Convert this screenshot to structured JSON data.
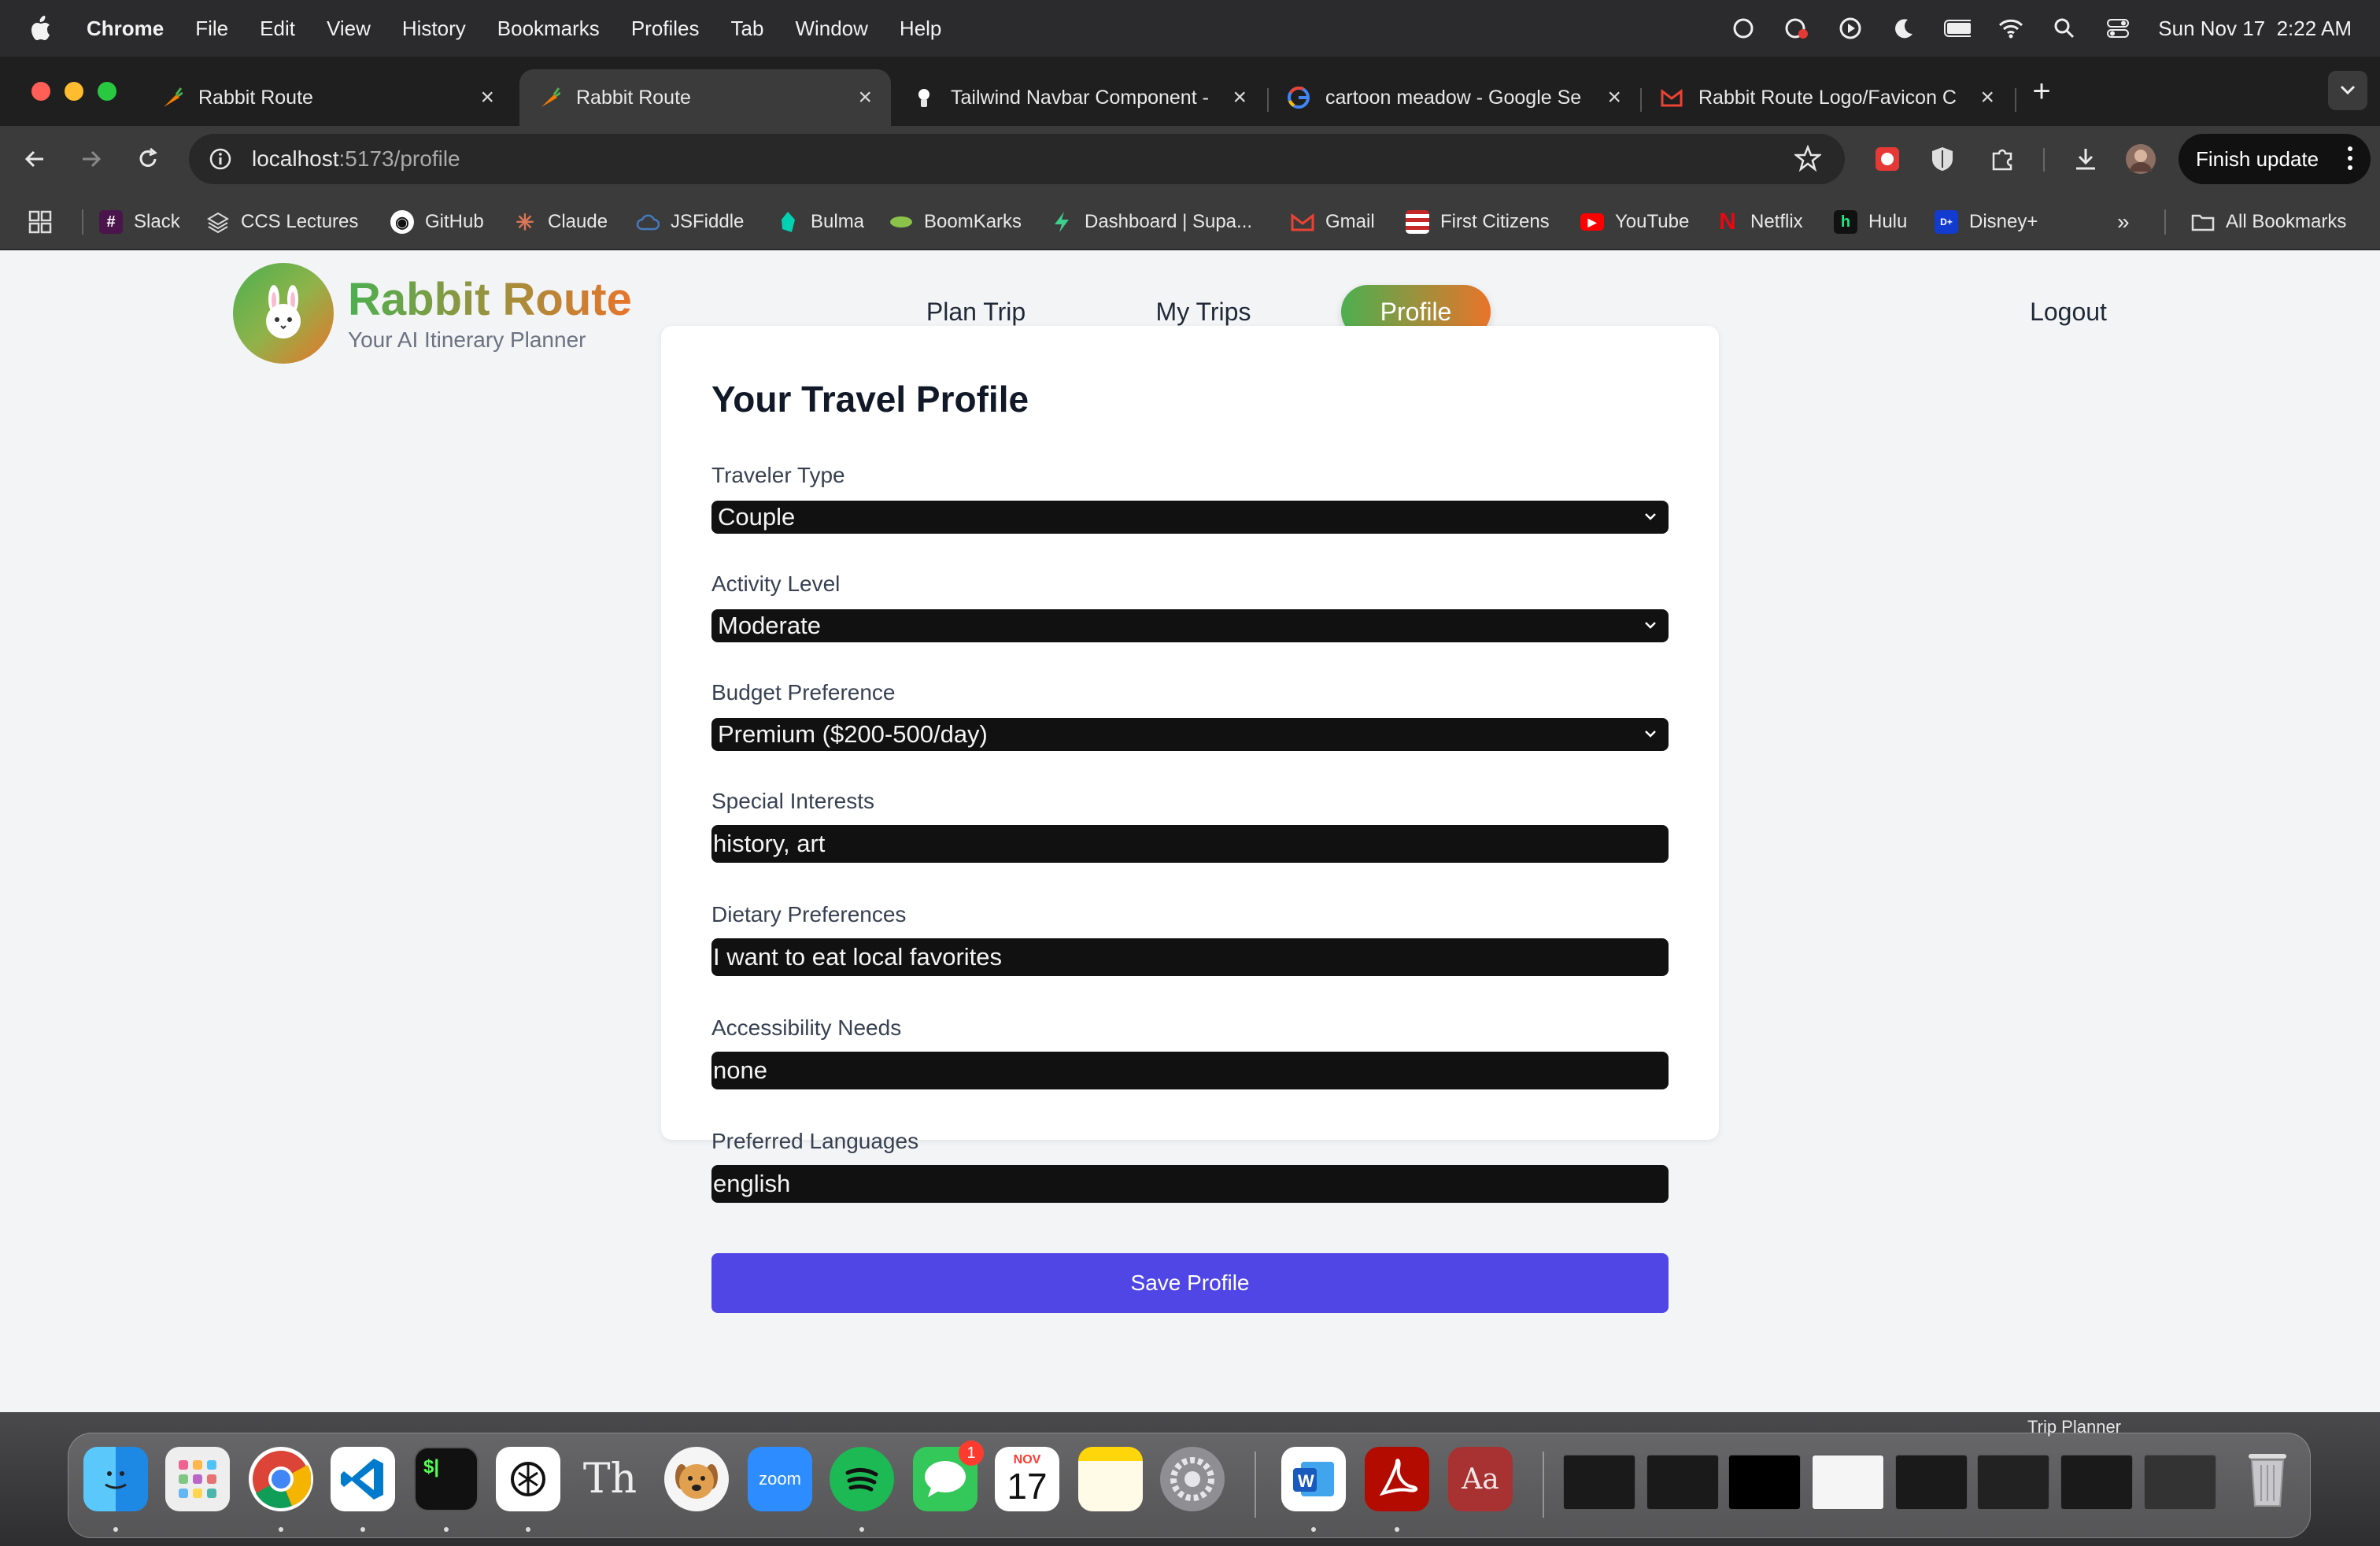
{
  "menubar": {
    "app": "Chrome",
    "items": [
      "File",
      "Edit",
      "View",
      "History",
      "Bookmarks",
      "Profiles",
      "Tab",
      "Window",
      "Help"
    ],
    "clock": "Sun Nov 17  2:22 AM"
  },
  "tabs": [
    {
      "title": "Rabbit Route",
      "favicon": "carrot-icon"
    },
    {
      "title": "Rabbit Route",
      "favicon": "carrot-icon",
      "active": true
    },
    {
      "title": "Tailwind Navbar Component -",
      "favicon": "tailwind-icon"
    },
    {
      "title": "cartoon meadow - Google Se",
      "favicon": "google-icon"
    },
    {
      "title": "Rabbit Route Logo/Favicon C",
      "favicon": "gmail-icon"
    }
  ],
  "toolbar": {
    "url_host": "localhost",
    "url_path": ":5173/profile",
    "finish_update": "Finish update"
  },
  "bookmarks": [
    {
      "label": "Slack",
      "icon": "slack-icon",
      "color": "#e01e5a"
    },
    {
      "label": "CCS Lectures",
      "icon": "layers-icon",
      "color": "#888888"
    },
    {
      "label": "GitHub",
      "icon": "github-icon",
      "color": "#ffffff"
    },
    {
      "label": "Claude",
      "icon": "claude-icon",
      "color": "#d97757"
    },
    {
      "label": "JSFiddle",
      "icon": "cloud-icon",
      "color": "#4679bd"
    },
    {
      "label": "Bulma",
      "icon": "bulma-icon",
      "color": "#00d1b2"
    },
    {
      "label": "BoomKarks",
      "icon": "boom-icon",
      "color": "#8bc34a"
    },
    {
      "label": "Dashboard | Supa...",
      "icon": "supabase-icon",
      "color": "#3ecf8e"
    },
    {
      "label": "Gmail",
      "icon": "gmail-icon",
      "color": "#ea4335"
    },
    {
      "label": "First Citizens",
      "icon": "flag-icon",
      "color": "#1e4a8c"
    },
    {
      "label": "YouTube",
      "icon": "youtube-icon",
      "color": "#ff0000"
    },
    {
      "label": "Netflix",
      "icon": "netflix-icon",
      "color": "#e50914"
    },
    {
      "label": "Hulu",
      "icon": "hulu-icon",
      "color": "#1ce783"
    },
    {
      "label": "Disney+",
      "icon": "disney-icon",
      "color": "#113ccf"
    }
  ],
  "all_bookmarks": "All Bookmarks",
  "app": {
    "brand": "Rabbit Route",
    "tagline": "Your AI Itinerary Planner",
    "nav": {
      "plan": "Plan Trip",
      "trips": "My Trips",
      "profile": "Profile",
      "logout": "Logout"
    },
    "form": {
      "title": "Your Travel Profile",
      "traveler_type": {
        "label": "Traveler Type",
        "value": "Couple"
      },
      "activity_level": {
        "label": "Activity Level",
        "value": "Moderate"
      },
      "budget": {
        "label": "Budget Preference",
        "value": "Premium ($200-500/day)"
      },
      "interests": {
        "label": "Special Interests",
        "value": "history, art"
      },
      "dietary": {
        "label": "Dietary Preferences",
        "value": "I want to eat local favorites"
      },
      "accessibility": {
        "label": "Accessibility Needs",
        "value": "none"
      },
      "languages": {
        "label": "Preferred Languages",
        "value": "english"
      },
      "save": "Save Profile"
    }
  },
  "dock": {
    "label": "Trip Planner",
    "badge": "1",
    "calendar_month": "NOV",
    "calendar_day": "17",
    "zoom": "zoom",
    "dictionary": "Aa",
    "terminal": "$|",
    "th": "Th"
  }
}
